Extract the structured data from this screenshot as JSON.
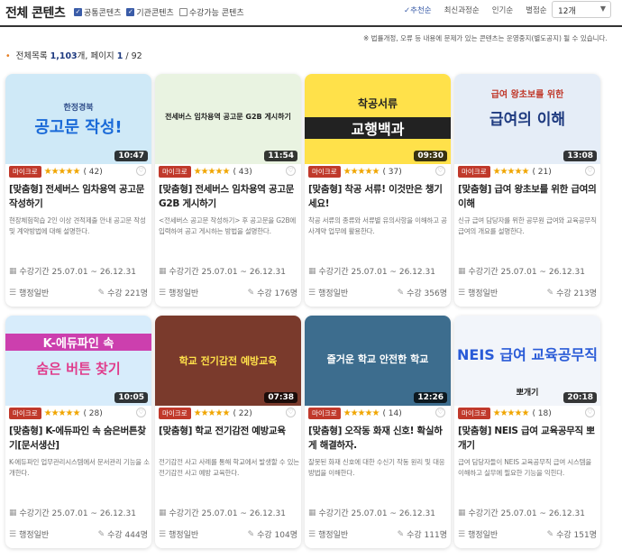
{
  "header": {
    "title": "전체 콘텐츠",
    "filters": [
      {
        "label": "공통콘텐츠",
        "checked": true
      },
      {
        "label": "기관콘텐츠",
        "checked": true
      },
      {
        "label": "수강가능 콘텐츠",
        "checked": false
      }
    ],
    "sorts": [
      "추천순",
      "최신과정순",
      "인기순",
      "별점순"
    ],
    "page_size": "12개"
  },
  "notice": "※ 법률개정, 오류 등 내용에 문제가 있는 콘텐츠는 운영중지(별도공지) 될 수 있습니다.",
  "summary": {
    "prefix": "전체목록",
    "count": "1,103",
    "unit": "개, 페이지",
    "page": "1",
    "total_pages": "/ 92"
  },
  "cards": [
    {
      "thumb": "공고문 작성!",
      "thumb_sub": "한정경북",
      "duration": "10:47",
      "badge": "마이크로",
      "rating": 5,
      "count": "( 42)",
      "title": "[맞춤형] 전세버스 임차용역 공고문 작성하기",
      "desc": "현장체험학습 2인 이상 견적제출 안내 공고문 작성 및 계약방법에 대해 설명한다.",
      "period": "수강기간 25.07.01 ~ 26.12.31",
      "category": "행정일반",
      "students": "수강 221명"
    },
    {
      "thumb": "전세버스 임차용역 공고문 G2B 게시하기",
      "thumb_sub": "",
      "duration": "11:54",
      "badge": "마이크로",
      "rating": 5,
      "count": "( 43)",
      "title": "[맞춤형] 전세버스 임차용역 공고문 G2B 게시하기",
      "desc": "<전세버스 공고문 작성하기> 후 공고문을 G2B에 입력하여 공고 게시하는 방법을 설명한다.",
      "period": "수강기간 25.07.01 ~ 26.12.31",
      "category": "행정일반",
      "students": "수강 176명"
    },
    {
      "thumb": "교행백과",
      "thumb_sub": "착공서류",
      "duration": "09:30",
      "badge": "마이크로",
      "rating": 5,
      "count": "( 37)",
      "title": "[맞춤형] 착공 서류! 이것만은 챙기세요!",
      "desc": "착공 서류의 종류와 서류별 유의사항을 이해하고 공사계약 업무에 활용한다.",
      "period": "수강기간 25.07.01 ~ 26.12.31",
      "category": "행정일반",
      "students": "수강 356명"
    },
    {
      "thumb": "급여의 이해",
      "thumb_sub": "급여 왕초보를 위한",
      "duration": "13:08",
      "badge": "마이크로",
      "rating": 5,
      "count": "( 21)",
      "title": "[맞춤형] 급여 왕초보를 위한 급여의 이해",
      "desc": "신규 급여 담당자를 위한 공무원 급여와 교육공무직 급여의 개요를 설명한다.",
      "period": "수강기간 25.07.01 ~ 26.12.31",
      "category": "행정일반",
      "students": "수강 213명"
    },
    {
      "thumb": "숨은 버튼 찾기",
      "thumb_sub": "K-에듀파인 속",
      "duration": "10:05",
      "badge": "마이크로",
      "rating": 5,
      "count": "( 28)",
      "title": "[맞춤형] K-에듀파인 속 숨은버튼찾기[문서생산]",
      "desc": "K-에듀파인 업무관리시스템에서 문서관리 기능을 소개한다.",
      "period": "수강기간 25.07.01 ~ 26.12.31",
      "category": "행정일반",
      "students": "수강 444명"
    },
    {
      "thumb": "학교 전기감전 예방교육",
      "thumb_sub": "",
      "duration": "07:38",
      "badge": "마이크로",
      "rating": 5,
      "count": "( 22)",
      "title": "[맞춤형] 학교 전기감전 예방교육",
      "desc": "전기감전 사고 사례를 통해 학교에서 발생할 수 있는 전기감전 사고 예방 교육한다.",
      "period": "수강기간 25.07.01 ~ 26.12.31",
      "category": "행정일반",
      "students": "수강 104명"
    },
    {
      "thumb": "즐거운 학교 안전한 학교",
      "thumb_sub": "",
      "duration": "12:26",
      "badge": "마이크로",
      "rating": 5,
      "count": "( 14)",
      "title": "[맞춤형] 오작동 화재 신호! 확실하게 해결하자.",
      "desc": "잘못된 화재 신호에 대한 수신기 작동 원리 및 대응 방법을 이해한다.",
      "period": "수강기간 25.07.01 ~ 26.12.31",
      "category": "행정일반",
      "students": "수강 111명"
    },
    {
      "thumb": "NEIS 급여 교육공무직",
      "thumb_sub": "뽀개기",
      "duration": "20:18",
      "badge": "마이크로",
      "rating": 5,
      "count": "( 18)",
      "title": "[맞춤형] NEIS 급여 교육공무직 뽀개기",
      "desc": "급여 담당자들이 NEIS 교육공무직 급여 시스템을 이해하고 실무에 필요한 기능을 익힌다.",
      "period": "수강기간 25.07.01 ~ 26.12.31",
      "category": "행정일반",
      "students": "수강 151명"
    }
  ],
  "thumb_colors": [
    "#cfe9f7",
    "#e9f3e1",
    "#ffe14a",
    "#e5edf7",
    "#d7ecfb",
    "#7a3a2c",
    "#3d6d8e",
    "#f2f5fa"
  ]
}
